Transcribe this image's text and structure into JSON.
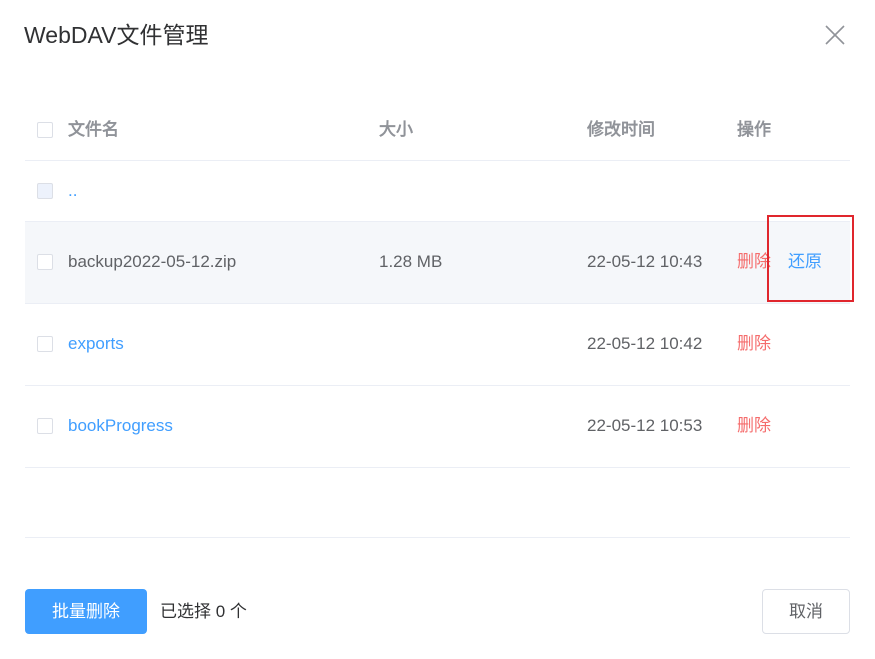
{
  "dialog": {
    "title": "WebDAV文件管理"
  },
  "table": {
    "headers": {
      "name": "文件名",
      "size": "大小",
      "time": "修改时间",
      "actions": "操作"
    },
    "parent_dir": "..",
    "rows": [
      {
        "name": "backup2022-05-12.zip",
        "size": "1.28 MB",
        "time": "22-05-12 10:43",
        "delete": "删除",
        "restore": "还原"
      },
      {
        "name": "exports",
        "size": "",
        "time": "22-05-12 10:42",
        "delete": "删除"
      },
      {
        "name": "bookProgress",
        "size": "",
        "time": "22-05-12 10:53",
        "delete": "删除"
      }
    ]
  },
  "footer": {
    "batch_delete": "批量删除",
    "selected_count": "已选择 0 个",
    "cancel": "取消"
  },
  "colors": {
    "primary": "#409eff",
    "danger": "#f56c6c",
    "highlight": "#e0262d",
    "hover_row": "#f5f7fa"
  }
}
